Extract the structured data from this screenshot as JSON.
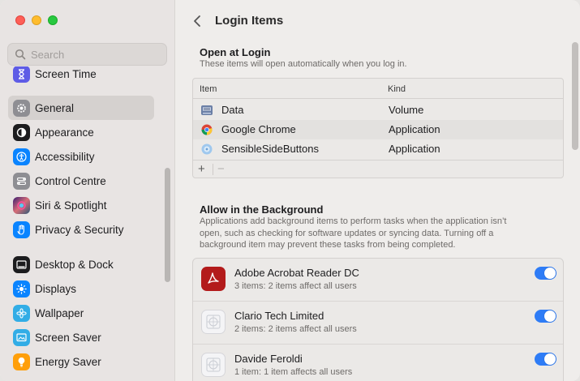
{
  "window": {
    "traffic_lights": [
      "close",
      "minimize",
      "zoom"
    ]
  },
  "sidebar": {
    "search_placeholder": "Search",
    "items": [
      {
        "label": "Screen Time",
        "icon": "hourglass-icon",
        "color": "#5e5ce6",
        "selected": false
      },
      {
        "label": "General",
        "icon": "gear-icon",
        "color": "#8e8e93",
        "selected": true
      },
      {
        "label": "Appearance",
        "icon": "appearance-icon",
        "color": "#1c1c1e",
        "selected": false
      },
      {
        "label": "Accessibility",
        "icon": "accessibility-icon",
        "color": "#0a84ff",
        "selected": false
      },
      {
        "label": "Control Centre",
        "icon": "control-centre-icon",
        "color": "#8e8e93",
        "selected": false
      },
      {
        "label": "Siri & Spotlight",
        "icon": "siri-icon",
        "color": "#bf5af2",
        "selected": false
      },
      {
        "label": "Privacy & Security",
        "icon": "hand-icon",
        "color": "#0a84ff",
        "selected": false
      },
      {
        "label": "Desktop & Dock",
        "icon": "dock-icon",
        "color": "#1c1c1e",
        "selected": false
      },
      {
        "label": "Displays",
        "icon": "sun-icon",
        "color": "#0a84ff",
        "selected": false
      },
      {
        "label": "Wallpaper",
        "icon": "flower-icon",
        "color": "#32ade6",
        "selected": false
      },
      {
        "label": "Screen Saver",
        "icon": "screen-saver-icon",
        "color": "#32ade6",
        "selected": false
      },
      {
        "label": "Energy Saver",
        "icon": "lightbulb-icon",
        "color": "#ff9f0a",
        "selected": false
      }
    ]
  },
  "main": {
    "title": "Login Items",
    "open_at_login": {
      "heading": "Open at Login",
      "subtitle": "These items will open automatically when you log in.",
      "columns": [
        "Item",
        "Kind"
      ],
      "rows": [
        {
          "name": "Data",
          "kind": "Volume",
          "icon": "volume-icon"
        },
        {
          "name": "Google Chrome",
          "kind": "Application",
          "icon": "chrome-icon"
        },
        {
          "name": "SensibleSideButtons",
          "kind": "Application",
          "icon": "app-icon"
        }
      ],
      "add_label": "+",
      "remove_label": "−"
    },
    "background": {
      "heading": "Allow in the Background",
      "subtitle_lines": [
        "Applications add background items to perform tasks when the application isn’t",
        "open, such as checking for software updates or syncing data. Turning off a",
        "background item may prevent these tasks from being completed."
      ],
      "items": [
        {
          "name": "Adobe Acrobat Reader DC",
          "detail": "3 items: 2 items affect all users",
          "icon": "acrobat-icon",
          "enabled": true
        },
        {
          "name": "Clario Tech Limited",
          "detail": "2 items: 2 items affect all users",
          "icon": "generic-app-icon",
          "enabled": true
        },
        {
          "name": "Davide Feroldi",
          "detail": "1 item: 1 item affects all users",
          "icon": "generic-app-icon",
          "enabled": true
        }
      ]
    }
  }
}
